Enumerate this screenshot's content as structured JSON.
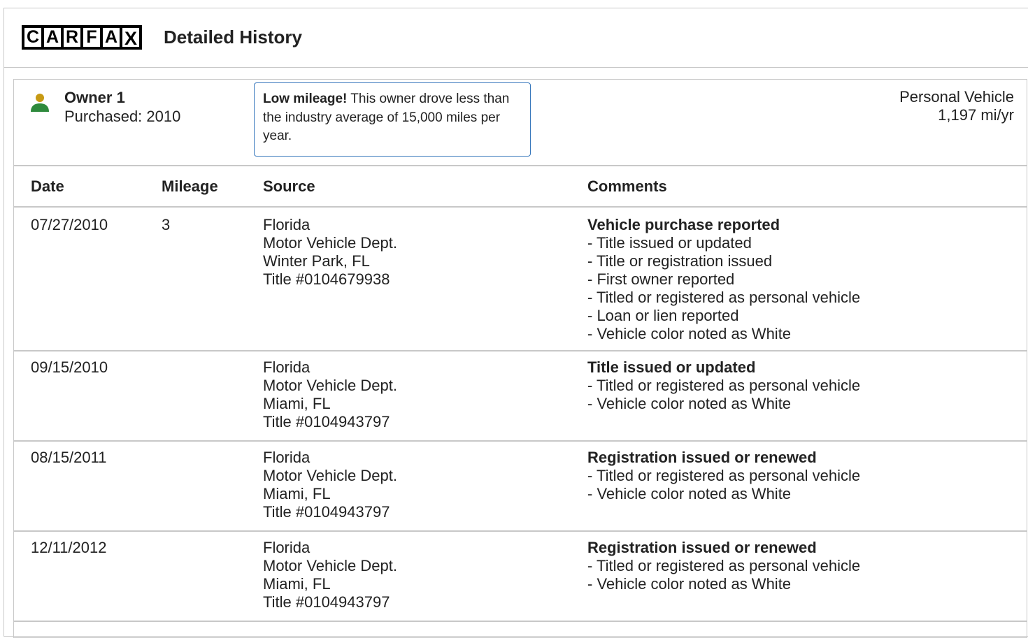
{
  "header": {
    "logo_letters": [
      "C",
      "A",
      "R",
      "F",
      "A",
      "X"
    ],
    "title": "Detailed History"
  },
  "owner": {
    "icon": "person-icon",
    "name": "Owner 1",
    "purchased": "Purchased: 2010",
    "notice_bold": "Low mileage!",
    "notice_text": " This owner drove less than the industry average of 15,000 miles per year.",
    "vehicle_type": "Personal Vehicle",
    "annual_mileage": "1,197 mi/yr",
    "colors": {
      "icon_head": "#c79a14",
      "icon_body": "#2e8a3c",
      "notice_border": "#3777bc"
    }
  },
  "table": {
    "headers": [
      "Date",
      "Mileage",
      "Source",
      "Comments"
    ],
    "rows": [
      {
        "date": "07/27/2010",
        "mileage": "3",
        "source": [
          "Florida",
          "Motor Vehicle Dept.",
          "Winter Park, FL",
          "Title #0104679938"
        ],
        "comment_title": "Vehicle purchase reported",
        "comments": [
          "- Title issued or updated",
          "- Title or registration issued",
          "- First owner reported",
          "- Titled or registered as personal vehicle",
          "- Loan or lien reported",
          "- Vehicle color noted as White"
        ]
      },
      {
        "date": "09/15/2010",
        "mileage": "",
        "source": [
          "Florida",
          "Motor Vehicle Dept.",
          "Miami, FL",
          "Title #0104943797"
        ],
        "comment_title": "Title issued or updated",
        "comments": [
          "- Titled or registered as personal vehicle",
          "- Vehicle color noted as White"
        ]
      },
      {
        "date": "08/15/2011",
        "mileage": "",
        "source": [
          "Florida",
          "Motor Vehicle Dept.",
          "Miami, FL",
          "Title #0104943797"
        ],
        "comment_title": "Registration issued or renewed",
        "comments": [
          "- Titled or registered as personal vehicle",
          "- Vehicle color noted as White"
        ]
      },
      {
        "date": "12/11/2012",
        "mileage": "",
        "source": [
          "Florida",
          "Motor Vehicle Dept.",
          "Miami, FL",
          "Title #0104943797"
        ],
        "comment_title": "Registration issued or renewed",
        "comments": [
          "- Titled or registered as personal vehicle",
          "- Vehicle color noted as White"
        ]
      }
    ]
  }
}
